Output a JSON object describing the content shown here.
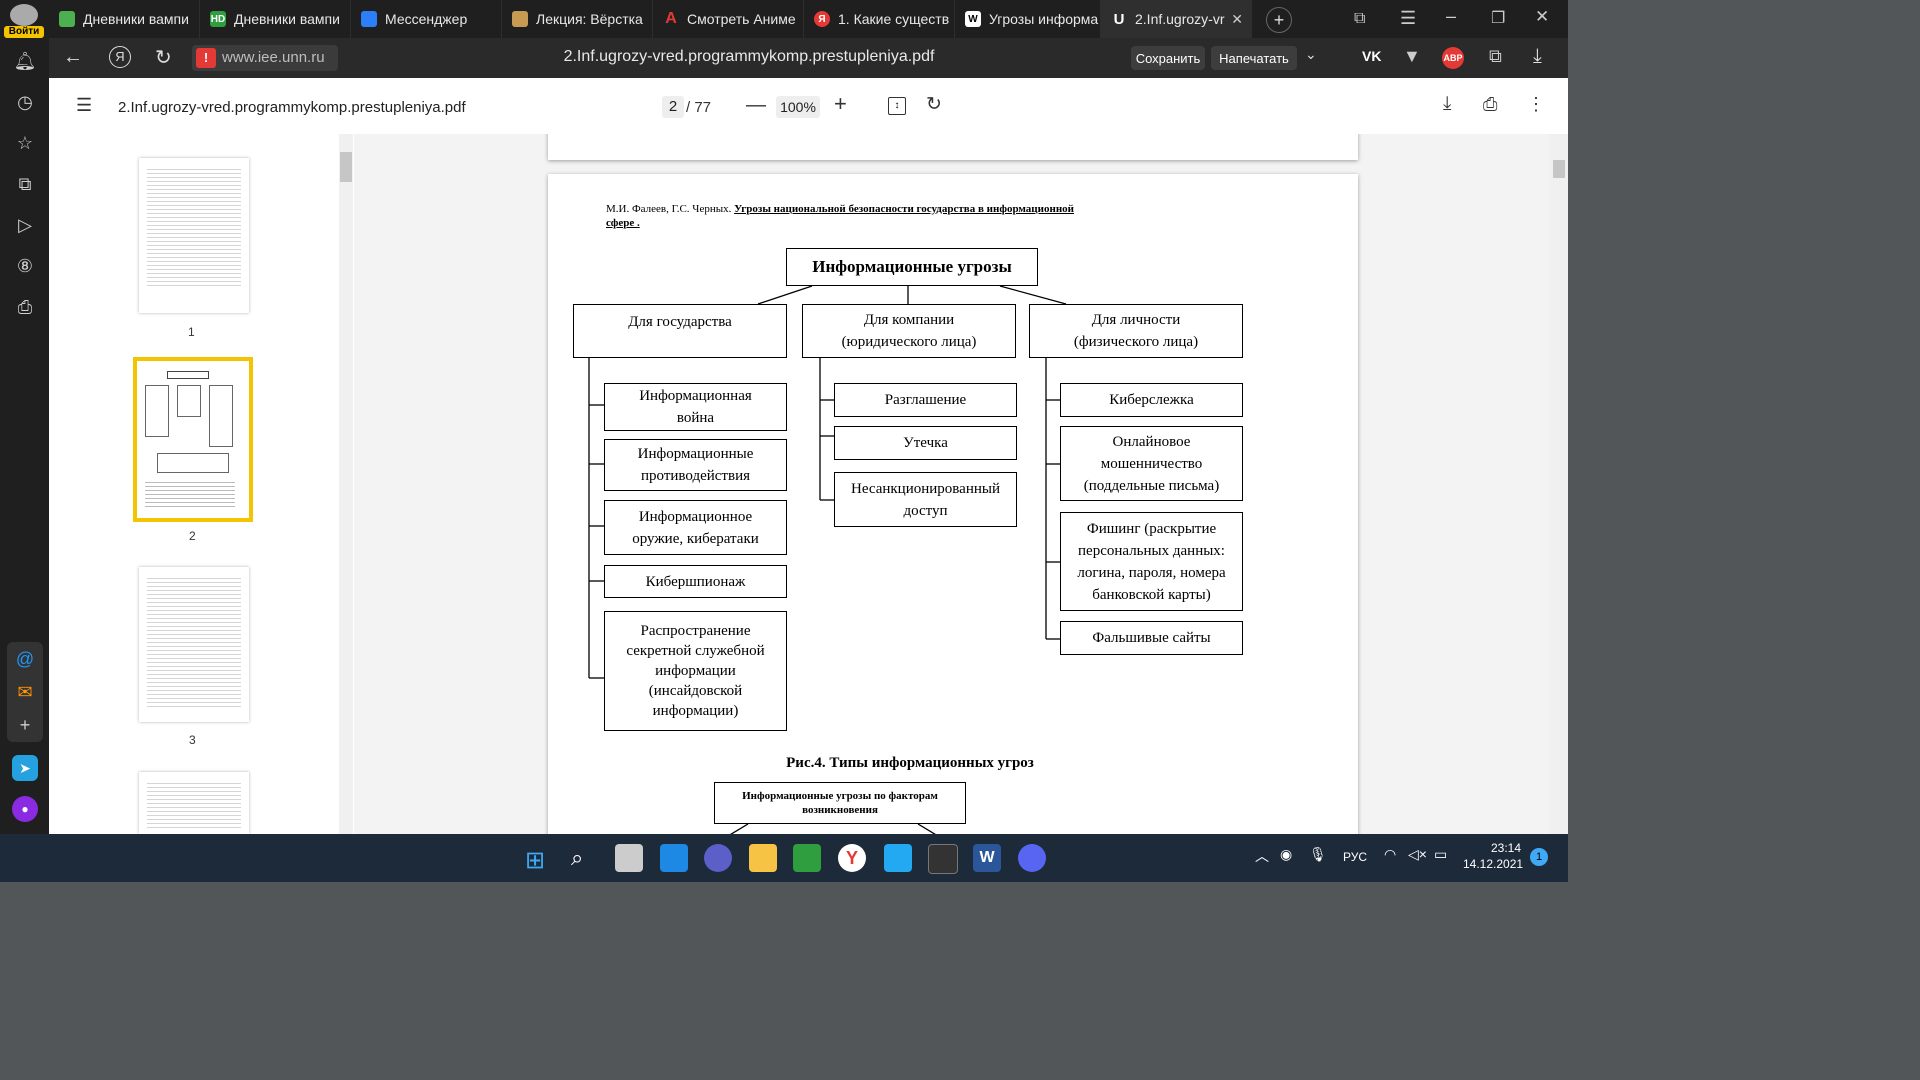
{
  "sidebar": {
    "login_label": "Войти"
  },
  "tabs": [
    {
      "title": "Дневники вампи",
      "color": "#4caf50",
      "glyph": "▭"
    },
    {
      "title": "Дневники вампи",
      "color": "#2e9e3e",
      "glyph": "HD"
    },
    {
      "title": "Мессенджер",
      "color": "#2d7ff9",
      "glyph": "●"
    },
    {
      "title": "Лекция: Вёрстка",
      "color": "#c89b52",
      "glyph": "▤"
    },
    {
      "title": "Смотреть Аниме",
      "color": "#1f1f1f",
      "glyph": "A"
    },
    {
      "title": "1. Какие существ",
      "color": "#e53935",
      "glyph": "Я"
    },
    {
      "title": "Угрозы информа",
      "color": "#ffffff",
      "glyph": "W"
    },
    {
      "title": "2.Inf.ugrozy-vr",
      "color": "#2f2f2f",
      "glyph": "U"
    }
  ],
  "address": {
    "domain": "www.iee.unn.ru",
    "page_title": "2.Inf.ugrozy-vred.programmykomp.prestupleniya.pdf",
    "save_label": "Сохранить",
    "print_label": "Напечатать",
    "abp": "ABP"
  },
  "pdf": {
    "filename": "2.Inf.ugrozy-vred.programmykomp.prestupleniya.pdf",
    "current_page": "2",
    "total_pages": "/ 77",
    "zoom": "100%",
    "thumbnails": [
      "1",
      "2",
      "3"
    ]
  },
  "doc": {
    "header_authors": "М.И. Фалеев, Г.С. Черных.",
    "header_title_1": "Угрозы национальной безопасности государства в информационной",
    "header_title_2": "сфере .",
    "root": "Информационные угрозы",
    "col1_head": "Для государства",
    "col2_head_1": "Для компании",
    "col2_head_2": "(юридического лица)",
    "col3_head_1": "Для личности",
    "col3_head_2": "(физического лица)",
    "col1_items": [
      [
        "Информационная",
        "война"
      ],
      [
        "Информационные",
        "противодействия"
      ],
      [
        "Информационное",
        "оружие, кибератаки"
      ],
      [
        "Кибершпионаж"
      ],
      [
        "Распространение",
        "секретной служебной",
        "информации",
        "(инсайдовской",
        "информации)"
      ]
    ],
    "col2_items": [
      [
        "Разглашение"
      ],
      [
        "Утечка"
      ],
      [
        "Несанкционированный",
        "доступ"
      ]
    ],
    "col3_items": [
      [
        "Киберслежка"
      ],
      [
        "Онлайновое",
        "мошенничество",
        "(поддельные письма)"
      ],
      [
        "Фишинг (раскрытие",
        "персональных данных:",
        "логина, пароля, номера",
        "банковской карты)"
      ],
      [
        "Фальшивые сайты"
      ]
    ],
    "caption": "Рис.4. Типы информационных угроз",
    "next_box_1": "Информационные угрозы по факторам",
    "next_box_2": "возникновения"
  },
  "taskbar": {
    "lang": "РУС",
    "time": "23:14",
    "date": "14.12.2021",
    "notif_count": "1"
  }
}
